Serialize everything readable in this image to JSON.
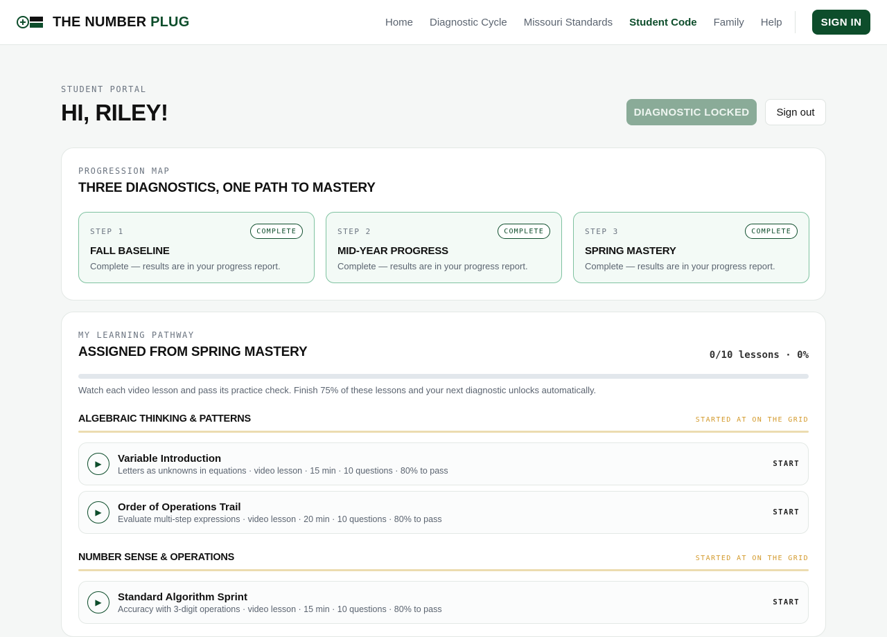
{
  "nav": {
    "brand_main": "THE NUMBER ",
    "brand_accent": "PLUG",
    "links": [
      "Home",
      "Diagnostic Cycle",
      "Missouri Standards",
      "Student Code",
      "Family",
      "Help"
    ],
    "active_link": "Student Code",
    "signin_label": "SIGN IN"
  },
  "header": {
    "eyebrow": "STUDENT PORTAL",
    "greeting": "HI, RILEY!",
    "locked_label": "DIAGNOSTIC LOCKED",
    "signout_label": "Sign out"
  },
  "progression": {
    "eyebrow": "PROGRESSION MAP",
    "title": "THREE DIAGNOSTICS, ONE PATH TO MASTERY",
    "steps": [
      {
        "num": "STEP 1",
        "badge": "COMPLETE",
        "title": "FALL BASELINE",
        "desc": "Complete — results are in your progress report."
      },
      {
        "num": "STEP 2",
        "badge": "COMPLETE",
        "title": "MID-YEAR PROGRESS",
        "desc": "Complete — results are in your progress report."
      },
      {
        "num": "STEP 3",
        "badge": "COMPLETE",
        "title": "SPRING MASTERY",
        "desc": "Complete — results are in your progress report."
      }
    ]
  },
  "pathway": {
    "eyebrow": "MY LEARNING PATHWAY",
    "title": "ASSIGNED FROM SPRING MASTERY",
    "progress_label": "0/10 lessons · 0%",
    "progress_fraction": 0,
    "note": "Watch each video lesson and pass its practice check. Finish 75% of these lessons and your next diagnostic unlocks automatically.",
    "sections": [
      {
        "name": "ALGEBRAIC THINKING & PATTERNS",
        "tag": "STARTED AT ON THE GRID",
        "lessons": [
          {
            "title": "Variable Introduction",
            "meta": "Letters as unknowns in equations · video lesson · 15 min · 10 questions · 80% to pass",
            "action": "START"
          },
          {
            "title": "Order of Operations Trail",
            "meta": "Evaluate multi-step expressions · video lesson · 20 min · 10 questions · 80% to pass",
            "action": "START"
          }
        ]
      },
      {
        "name": "NUMBER SENSE & OPERATIONS",
        "tag": "STARTED AT ON THE GRID",
        "lessons": [
          {
            "title": "Standard Algorithm Sprint",
            "meta": "Accuracy with 3-digit operations · video lesson · 15 min · 10 questions · 80% to pass",
            "action": "START"
          }
        ]
      }
    ]
  },
  "icons": {
    "play": "play-icon",
    "logo": "number-plug-logo"
  },
  "colors": {
    "brand": "#0d4d2b",
    "accent_gold": "#d39a2c",
    "locked": "#8aab98"
  }
}
